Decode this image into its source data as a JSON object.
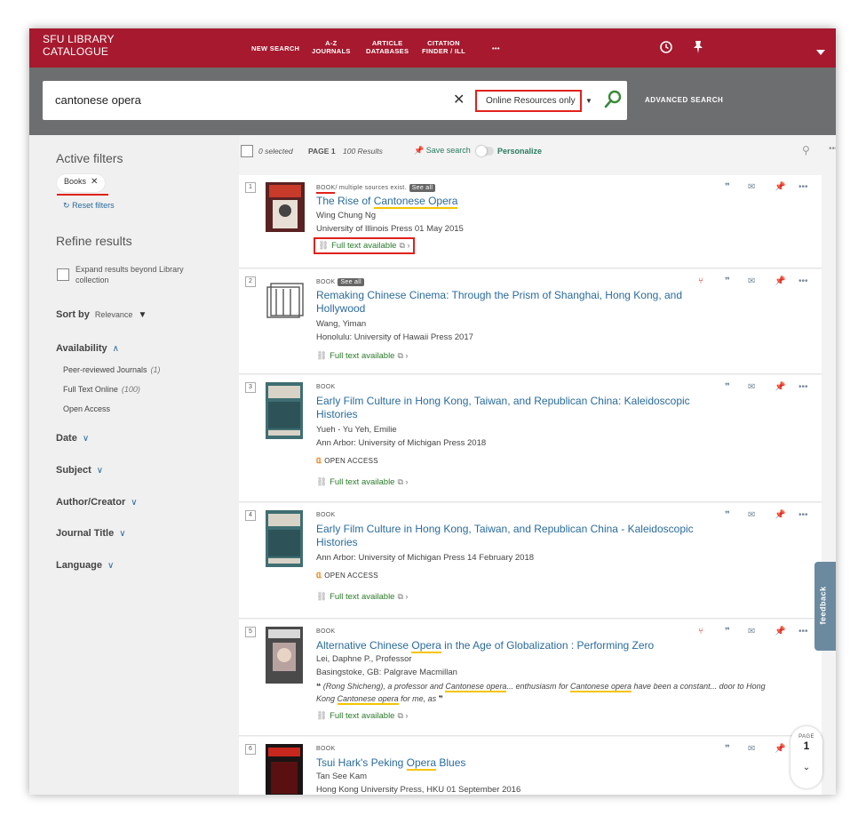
{
  "header": {
    "logo_line1": "SFU LIBRARY",
    "logo_line2": "CATALOGUE",
    "nav": [
      {
        "line1": "NEW SEARCH",
        "line2": ""
      },
      {
        "line1": "A-Z",
        "line2": "JOURNALS"
      },
      {
        "line1": "ARTICLE",
        "line2": "DATABASES"
      },
      {
        "line1": "CITATION",
        "line2": "FINDER / ILL"
      },
      {
        "line1": "•••",
        "line2": ""
      }
    ]
  },
  "search": {
    "query": "cantonese opera",
    "scope": "Online Resources only",
    "advanced": "ADVANCED SEARCH"
  },
  "sidebar": {
    "active_filters_title": "Active filters",
    "active_chip": "Books",
    "reset": "Reset filters",
    "refine_title": "Refine results",
    "expand_text": "Expand results beyond Library collection",
    "sort_label": "Sort by",
    "sort_value": "Relevance",
    "availability": "Availability",
    "availability_items": [
      {
        "label": "Peer-reviewed Journals",
        "count": "(1)"
      },
      {
        "label": "Full Text Online",
        "count": "(100)"
      },
      {
        "label": "Open Access",
        "count": ""
      }
    ],
    "facets": [
      "Date",
      "Subject",
      "Author/Creator",
      "Journal Title",
      "Language"
    ]
  },
  "results_header": {
    "selected": "0 selected",
    "page": "PAGE 1",
    "count": "100 Results",
    "save": "Save search",
    "personalize": "Personalize"
  },
  "results": [
    {
      "num": "1",
      "type": "BOOK",
      "multi": "/ multiple sources exist.",
      "see_all": "See all",
      "title_pre": "The Rise of ",
      "title_hl": "Cantonese Opera",
      "title_post": "",
      "line1": "Wing Chung Ng",
      "line2": "University of Illinois Press 01 May 2015",
      "fulltext": "Full text available"
    },
    {
      "num": "2",
      "type": "BOOK",
      "multi": "",
      "see_all": "See all",
      "title_pre": "Remaking Chinese Cinema: Through the Prism of Shanghai, Hong Kong, and Hollywood",
      "title_hl": "",
      "title_post": "",
      "line1": "Wang, Yiman",
      "line2": "Honolulu: University of Hawaii Press 2017",
      "fulltext": "Full text available"
    },
    {
      "num": "3",
      "type": "BOOK",
      "multi": "",
      "see_all": "",
      "title_pre": "Early Film Culture in Hong Kong, Taiwan, and Republican China: Kaleidoscopic Histories",
      "title_hl": "",
      "title_post": "",
      "line1": "Yueh - Yu Yeh, Emilie",
      "line2": "Ann Arbor: University of Michigan Press 2018",
      "oa": "OPEN ACCESS",
      "fulltext": "Full text available"
    },
    {
      "num": "4",
      "type": "BOOK",
      "multi": "",
      "see_all": "",
      "title_pre": "Early Film Culture in Hong Kong, Taiwan, and Republican China - Kaleidoscopic Histories",
      "title_hl": "",
      "title_post": "",
      "line1": "Ann Arbor: University of Michigan Press 14 February 2018",
      "line2": "",
      "oa": "OPEN ACCESS",
      "fulltext": "Full text available"
    },
    {
      "num": "5",
      "type": "BOOK",
      "multi": "",
      "see_all": "",
      "title_pre": "Alternative Chinese ",
      "title_hl": "Opera",
      "title_post": " in the Age of Globalization : Performing Zero",
      "line1": "Lei, Daphne P., Professor",
      "line2": "Basingstoke, GB: Palgrave Macmillan",
      "snippet_a": "(Rong Shicheng), a professor and ",
      "snippet_b": "Cantonese opera",
      "snippet_c": "... enthusiasm for ",
      "snippet_d": "Cantonese opera",
      "snippet_e": " have been a constant... door to Hong Kong ",
      "snippet_f": "Cantonese opera",
      "snippet_g": " for me, as",
      "fulltext": "Full text available"
    },
    {
      "num": "6",
      "type": "BOOK",
      "multi": "",
      "see_all": "",
      "title_pre": "Tsui Hark's Peking ",
      "title_hl": "Opera",
      "title_post": " Blues",
      "line1": "Tan See Kam",
      "line2": "Hong Kong University Press, HKU 01 September 2016",
      "fulltext": ""
    }
  ],
  "feedback": "feedback",
  "page_widget": {
    "label": "PAGE",
    "number": "1"
  }
}
